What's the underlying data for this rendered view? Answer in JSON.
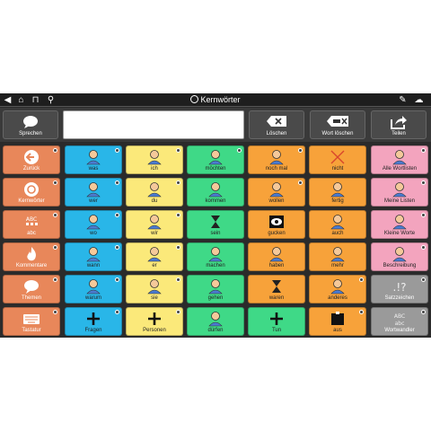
{
  "topbar": {
    "title": "Kernwörter",
    "icons": [
      "back-icon",
      "home-icon",
      "lock-icon",
      "search-icon",
      "pencil-icon",
      "cloud-gear-icon"
    ]
  },
  "actionbar": {
    "speak_label": "Sprechen",
    "message_value": "",
    "delete_label": "Löschen",
    "delete_word_label": "Wort löschen",
    "share_label": "Teilen"
  },
  "colors": {
    "nav": "#e8875a",
    "blue": "#29b6e8",
    "yellow": "#fbe97a",
    "green": "#3fd987",
    "orange": "#f7a23a",
    "pink": "#f3a4be",
    "gray": "#9a9a9a"
  },
  "nav": [
    {
      "label": "Zurück",
      "icon": "back-arrow-icon"
    },
    {
      "label": "Kernwörter",
      "icon": "core-words-icon"
    },
    {
      "label": "abc",
      "icon": "keyboard-grid-icon"
    },
    {
      "label": "Kommentare",
      "icon": "fire-icon"
    },
    {
      "label": "Themen",
      "icon": "speech-bubble-icon"
    },
    {
      "label": "Tastatur",
      "icon": "keyboard-icon"
    }
  ],
  "grid": [
    [
      {
        "label": "was",
        "color": "blue",
        "icon": "question-person-icon"
      },
      {
        "label": "ich",
        "color": "yellow",
        "icon": "person-self-icon"
      },
      {
        "label": "möchten",
        "color": "green",
        "icon": "want-icon"
      },
      {
        "label": "noch mal",
        "color": "orange",
        "icon": "again-icon"
      },
      {
        "label": "nicht",
        "color": "orange",
        "icon": "cross-icon"
      },
      {
        "label": "Alle Wortlisten",
        "color": "pink",
        "icon": "word-lists-icon"
      }
    ],
    [
      {
        "label": "wer",
        "color": "blue",
        "icon": "who-icon"
      },
      {
        "label": "du",
        "color": "yellow",
        "icon": "point-you-icon"
      },
      {
        "label": "kommen",
        "color": "green",
        "icon": "come-icon"
      },
      {
        "label": "wollen",
        "color": "orange",
        "icon": "want-hands-icon"
      },
      {
        "label": "fertig",
        "color": "orange",
        "icon": "finished-icon"
      },
      {
        "label": "Meine Listen",
        "color": "pink",
        "icon": "my-lists-icon"
      }
    ],
    [
      {
        "label": "wo",
        "color": "blue",
        "icon": "where-icon"
      },
      {
        "label": "wir",
        "color": "yellow",
        "icon": "we-icon"
      },
      {
        "label": "sein",
        "color": "green",
        "icon": "hourglass-icon"
      },
      {
        "label": "gucken",
        "color": "orange",
        "icon": "eye-icon"
      },
      {
        "label": "auch",
        "color": "orange",
        "icon": "also-hands-icon"
      },
      {
        "label": "Kleine Worte",
        "color": "pink",
        "icon": "small-words-icon"
      }
    ],
    [
      {
        "label": "wann",
        "color": "blue",
        "icon": "when-icon"
      },
      {
        "label": "er",
        "color": "yellow",
        "icon": "he-icon"
      },
      {
        "label": "machen",
        "color": "green",
        "icon": "make-icon"
      },
      {
        "label": "haben",
        "color": "orange",
        "icon": "have-icon"
      },
      {
        "label": "mehr",
        "color": "orange",
        "icon": "more-icon"
      },
      {
        "label": "Beschreibung",
        "color": "pink",
        "icon": "description-icon"
      }
    ],
    [
      {
        "label": "warum",
        "color": "blue",
        "icon": "why-icon"
      },
      {
        "label": "sie",
        "color": "yellow",
        "icon": "she-icon"
      },
      {
        "label": "gehen",
        "color": "green",
        "icon": "walk-icon"
      },
      {
        "label": "waren",
        "color": "orange",
        "icon": "hourglass-past-icon"
      },
      {
        "label": "anderes",
        "color": "orange",
        "icon": "other-icon"
      },
      {
        "label": "Satzzeichen",
        "color": "gray",
        "icon": "punctuation-icon"
      }
    ],
    [
      {
        "label": "Fragen",
        "color": "blue",
        "icon": "plus-icon"
      },
      {
        "label": "Personen",
        "color": "yellow",
        "icon": "plus-icon"
      },
      {
        "label": "dürfen",
        "color": "green",
        "icon": "police-icon"
      },
      {
        "label": "Tun",
        "color": "green",
        "icon": "plus-icon"
      },
      {
        "label": "aus",
        "color": "orange",
        "icon": "out-icon"
      },
      {
        "label": "Wortwandler",
        "color": "gray",
        "icon": "word-changer-icon"
      }
    ]
  ]
}
